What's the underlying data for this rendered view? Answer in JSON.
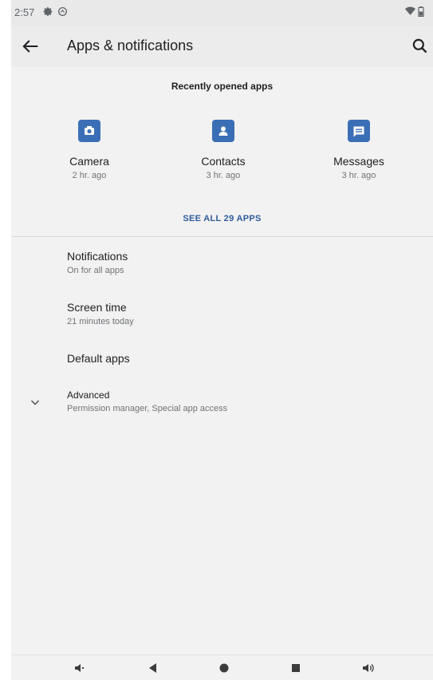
{
  "status_bar": {
    "time": "2:57",
    "icons": [
      "gear-icon",
      "signal-icon",
      "wifi-icon",
      "battery-icon"
    ]
  },
  "app_bar": {
    "title": "Apps & notifications",
    "back_icon": "arrow-back-icon",
    "search_icon": "search-icon"
  },
  "recent": {
    "header": "Recently opened apps",
    "apps": [
      {
        "name": "Camera",
        "time": "2 hr. ago",
        "icon": "camera-icon"
      },
      {
        "name": "Contacts",
        "time": "3 hr. ago",
        "icon": "contacts-icon"
      },
      {
        "name": "Messages",
        "time": "3 hr. ago",
        "icon": "messages-icon"
      }
    ],
    "see_all": "SEE ALL 29 APPS"
  },
  "preferences": [
    {
      "title": "Notifications",
      "subtitle": "On for all apps"
    },
    {
      "title": "Screen time",
      "subtitle": "21 minutes today"
    },
    {
      "title": "Default apps",
      "subtitle": ""
    },
    {
      "title": "Advanced",
      "subtitle": "Permission manager, Special app access",
      "icon": "chevron-down-icon"
    }
  ],
  "nav_bar": {
    "icons": [
      "volume-down-icon",
      "back-triangle-icon",
      "home-circle-icon",
      "recents-square-icon",
      "volume-up-icon"
    ]
  },
  "colors": {
    "accent": "#2f5d9b",
    "app_icon": "#3b6fb5",
    "background": "#f2f2f2"
  }
}
